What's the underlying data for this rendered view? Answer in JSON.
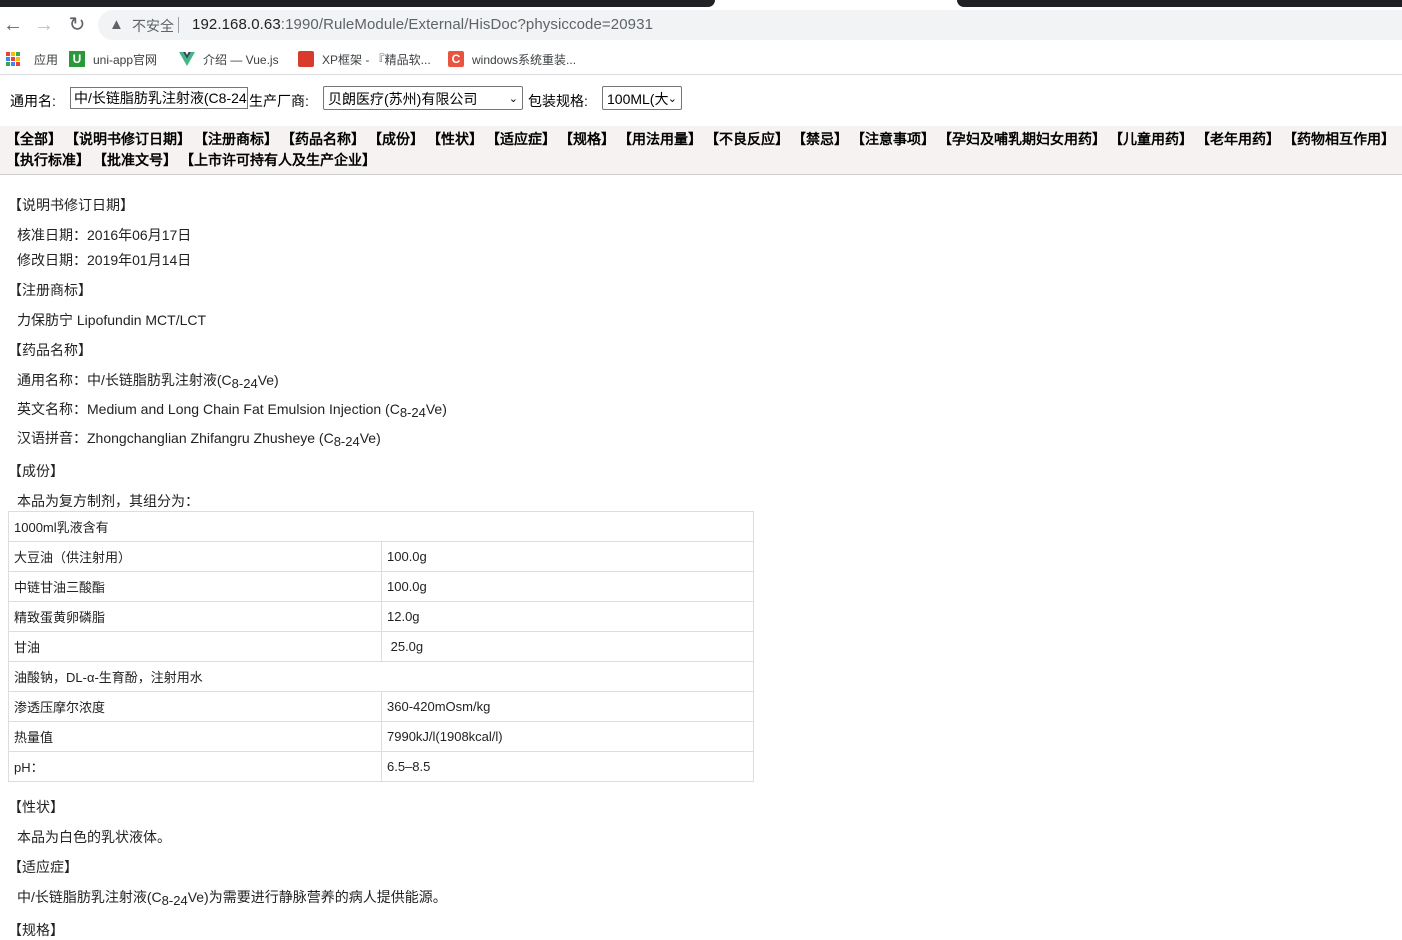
{
  "browser": {
    "nav": {
      "back": "←",
      "forward": "→",
      "reload": "↻"
    },
    "insecure_label": "不安全",
    "url_host": "192.168.0.63",
    "url_rest": ":1990/RuleModule/External/HisDoc?physiccode=20931"
  },
  "bookmarks": [
    {
      "label": "应用",
      "icon": "apps-grid-icon"
    },
    {
      "label": "uni-app官网",
      "icon": "uni-app-icon"
    },
    {
      "label": "介绍 — Vue.js",
      "icon": "vue-icon"
    },
    {
      "label": "XP框架 - 『精品软...",
      "icon": "xp-icon"
    },
    {
      "label": "windows系统重装...",
      "icon": "c-icon"
    }
  ],
  "filter": {
    "generic_label": "通用名:",
    "generic_value": "中/长链脂肪乳注射液(C8-24",
    "maker_label": "生产厂商:",
    "maker_value": "贝朗医疗(苏州)有限公司",
    "spec_label": "包装规格:",
    "spec_value": "100ML(大"
  },
  "sections_row1": [
    "【全部】",
    "【说明书修订日期】",
    "【注册商标】",
    "【药品名称】",
    "【成份】",
    "【性状】",
    "【适应症】",
    "【规格】",
    "【用法用量】",
    "【不良反应】",
    "【禁忌】",
    "【注意事项】",
    "【孕妇及哺乳期妇女用药】",
    "【儿童用药】",
    "【老年用药】",
    "【药物相互作用】"
  ],
  "sections_row2": [
    "【执行标准】",
    "【批准文号】",
    "【上市许可持有人及生产企业】"
  ],
  "doc": {
    "revision_title": "【说明书修订日期】",
    "approve_date": "核准日期：2016年06月17日",
    "modify_date": "修改日期：2019年01月14日",
    "trademark_title": "【注册商标】",
    "trademark": "力保肪宁 Lipofundin MCT/LCT",
    "name_title": "【药品名称】",
    "generic_prefix": "通用名称：中/长链脂肪乳注射液(C",
    "english_prefix": "英文名称：Medium and Long Chain Fat Emulsion Injection (C",
    "pinyin_prefix": "汉语拼音：Zhongchanglian Zhifangru Zhusheye (C",
    "sub": "8-24",
    "suffix": "Ve)",
    "composition_title": "【成份】",
    "composition_intro": "本品为复方制剂，其组分为：",
    "table": {
      "header": "1000ml乳液含有",
      "rows": [
        {
          "name": "大豆油（供注射用）",
          "value": "100.0g"
        },
        {
          "name": "中链甘油三酸酯",
          "value": "100.0g"
        },
        {
          "name": "精致蛋黄卵磷脂",
          "value": "12.0g"
        },
        {
          "name": "甘油",
          "value": " 25.0g"
        }
      ],
      "excipients": "油酸钠，DL-α-生育酚，注射用水",
      "rows2": [
        {
          "name": "渗透压摩尔浓度",
          "value": "360-420mOsm/kg"
        },
        {
          "name": "热量值",
          "value": "7990kJ/l(1908kcal/l)"
        },
        {
          "name": "pH：",
          "value": "6.5–8.5"
        }
      ]
    },
    "appearance_title": "【性状】",
    "appearance": "本品为白色的乳状液体。",
    "indication_title": "【适应症】",
    "indication_prefix": "中/长链脂肪乳注射液(C",
    "indication_suffix": "Ve)为需要进行静脉营养的病人提供能源。",
    "spec_title": "【规格】"
  }
}
